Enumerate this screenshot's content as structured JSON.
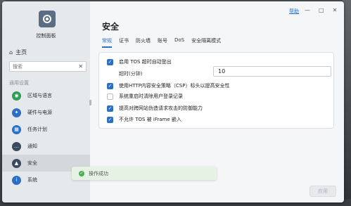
{
  "app": {
    "title": "控制面板",
    "help": "帮助",
    "win_min": "—",
    "win_max": "□",
    "win_close": "✕"
  },
  "sidebar": {
    "home": "主页",
    "search_placeholder": "搜索",
    "section": "通用设置",
    "items": [
      {
        "label": "区域与语言",
        "icon": "globe-icon",
        "color": "#2e9b57"
      },
      {
        "label": "硬件与电源",
        "icon": "bulb-icon",
        "color": "#2b6fc7"
      },
      {
        "label": "任务计划",
        "icon": "calendar-icon",
        "color": "#2b6fc7"
      },
      {
        "label": "通知",
        "icon": "chat-icon",
        "color": "#3a4a5c"
      },
      {
        "label": "安全",
        "icon": "lock-icon",
        "color": "#3a4a5c"
      },
      {
        "label": "系统",
        "icon": "info-icon",
        "color": "#2b6fc7"
      }
    ]
  },
  "main": {
    "title": "安全",
    "tabs": [
      "常规",
      "证书",
      "防火墙",
      "账号",
      "DoS",
      "安全隔离模式"
    ],
    "options": [
      {
        "label": "启用 TOS 超时自动登出",
        "checked": true
      },
      {
        "label": "使用HTTP内容安全策略（CSP）标头以提高安全性",
        "checked": true
      },
      {
        "label": "系统重启时清除用户登录记录",
        "checked": false
      },
      {
        "label": "提高对跨网站伪造请求攻击的防御能力",
        "checked": true
      },
      {
        "label": "不允许 TOS 被 iFrame 嵌入",
        "checked": true
      }
    ],
    "timeout_label": "超时(分钟)",
    "timeout_value": "10",
    "toast": "操作成功",
    "apply": "应用"
  }
}
